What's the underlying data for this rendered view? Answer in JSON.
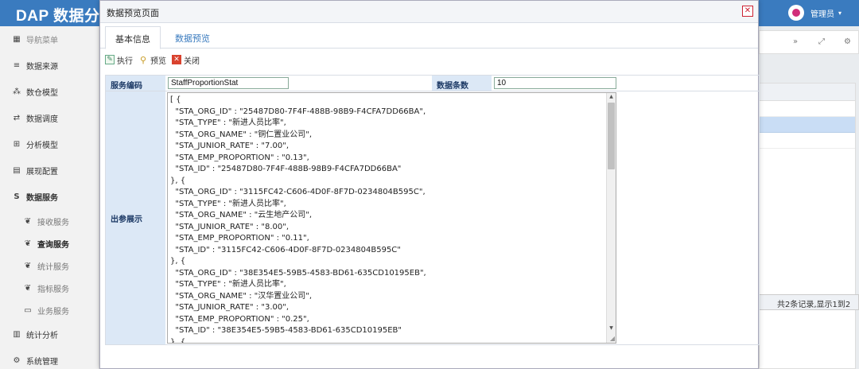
{
  "app": {
    "brand": "DAP 数据分析",
    "user_name": "管理员",
    "colors": {
      "header": "#3a7bbf",
      "label_bg": "#dce8f6",
      "close": "#d9422e"
    }
  },
  "sidebar": {
    "items": [
      {
        "label": "导航菜单",
        "icon": "grid-icon",
        "type": "head"
      },
      {
        "label": "数据来源",
        "icon": "database-icon",
        "type": "top"
      },
      {
        "label": "数仓模型",
        "icon": "cubes-icon",
        "type": "top"
      },
      {
        "label": "数据调度",
        "icon": "shuffle-icon",
        "type": "top"
      },
      {
        "label": "分析模型",
        "icon": "sitemap-icon",
        "type": "top"
      },
      {
        "label": "展现配置",
        "icon": "film-icon",
        "type": "top"
      },
      {
        "label": "数据服务",
        "icon": "dollar-icon",
        "type": "top-strong"
      },
      {
        "label": "接收服务",
        "icon": "leaf-icon",
        "type": "sub"
      },
      {
        "label": "查询服务",
        "icon": "leaf-icon",
        "type": "sub-active"
      },
      {
        "label": "统计服务",
        "icon": "leaf-icon",
        "type": "sub"
      },
      {
        "label": "指标服务",
        "icon": "leaf-icon",
        "type": "sub"
      },
      {
        "label": "业务服务",
        "icon": "folder-icon",
        "type": "sub"
      },
      {
        "label": "统计分析",
        "icon": "bar-chart-icon",
        "type": "top"
      },
      {
        "label": "系统管理",
        "icon": "gear-icon",
        "type": "top"
      }
    ]
  },
  "background": {
    "pager_text": "共2条记录,显示1到2"
  },
  "modal": {
    "title": "数据预览页面",
    "tabs": [
      {
        "label": "基本信息",
        "active": true
      },
      {
        "label": "数据预览",
        "active": false
      }
    ],
    "toolbar": {
      "run_label": "执行",
      "preview_label": "预览",
      "close_label": "关闭"
    },
    "form": {
      "service_code_label": "服务编码",
      "service_code_value": "StaffProportionStat",
      "count_label": "数据条数",
      "count_value": "10",
      "output_label": "出参展示",
      "output_json": "[ {\n  \"STA_ORG_ID\" : \"25487D80-7F4F-488B-98B9-F4CFA7DD66BA\",\n  \"STA_TYPE\" : \"新进人员比率\",\n  \"STA_ORG_NAME\" : \"铜仁置业公司\",\n  \"STA_JUNIOR_RATE\" : \"7.00\",\n  \"STA_EMP_PROPORTION\" : \"0.13\",\n  \"STA_ID\" : \"25487D80-7F4F-488B-98B9-F4CFA7DD66BA\"\n}, {\n  \"STA_ORG_ID\" : \"3115FC42-C606-4D0F-8F7D-0234804B595C\",\n  \"STA_TYPE\" : \"新进人员比率\",\n  \"STA_ORG_NAME\" : \"云生地产公司\",\n  \"STA_JUNIOR_RATE\" : \"8.00\",\n  \"STA_EMP_PROPORTION\" : \"0.11\",\n  \"STA_ID\" : \"3115FC42-C606-4D0F-8F7D-0234804B595C\"\n}, {\n  \"STA_ORG_ID\" : \"38E354E5-59B5-4583-BD61-635CD10195EB\",\n  \"STA_TYPE\" : \"新进人员比率\",\n  \"STA_ORG_NAME\" : \"汉华置业公司\",\n  \"STA_JUNIOR_RATE\" : \"3.00\",\n  \"STA_EMP_PROPORTION\" : \"0.25\",\n  \"STA_ID\" : \"38E354E5-59B5-4583-BD61-635CD10195EB\"\n}, {"
    }
  }
}
